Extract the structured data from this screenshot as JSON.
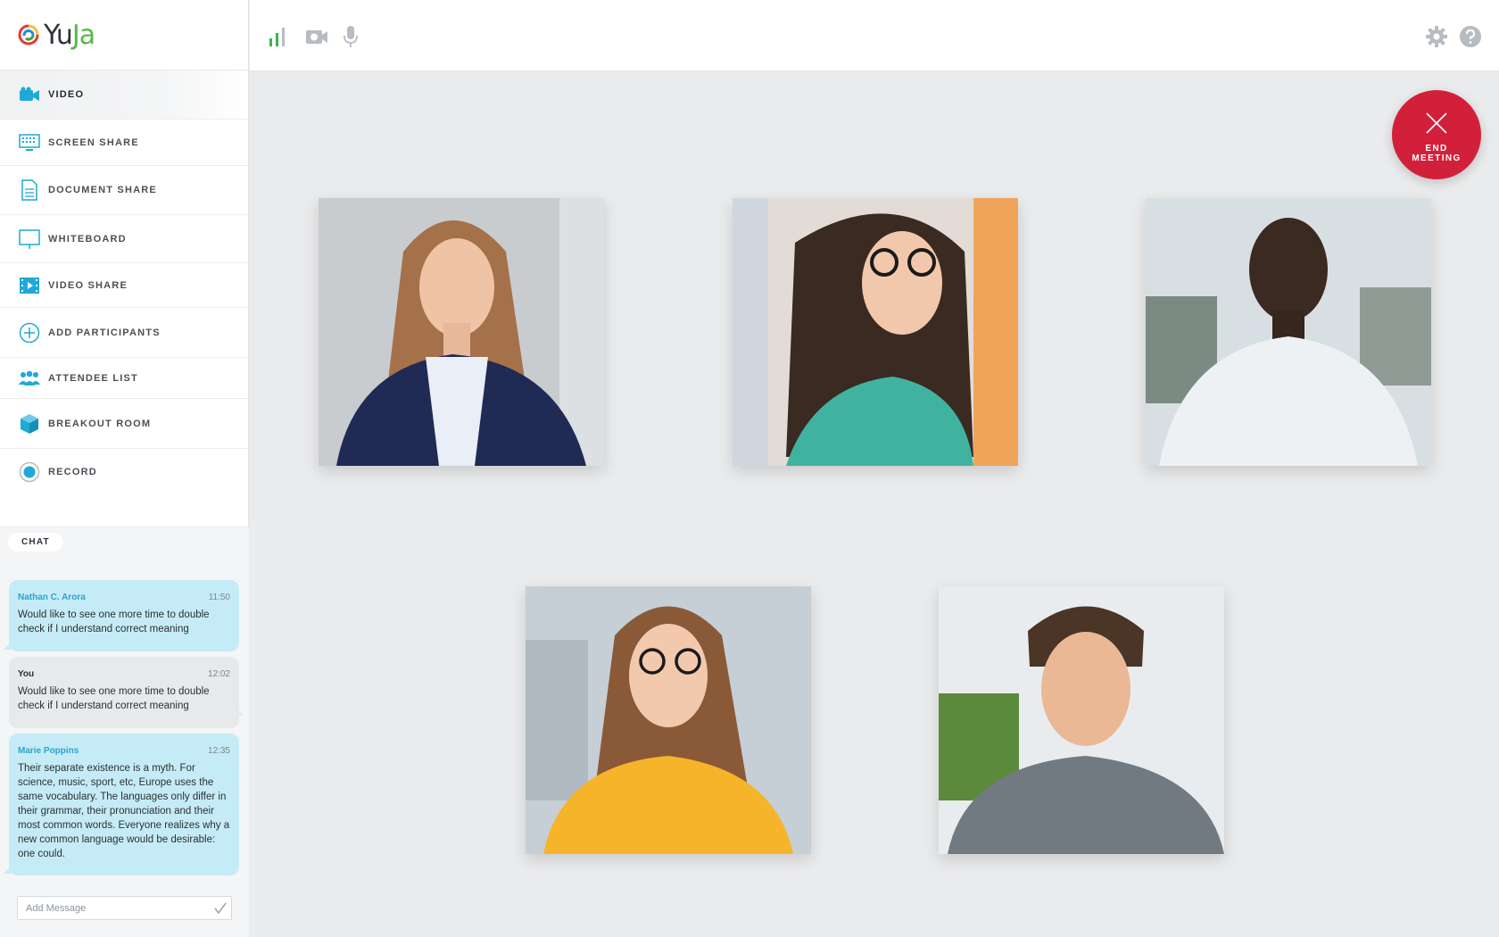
{
  "app": {
    "logo_left": "Yu",
    "logo_right": "Ja"
  },
  "sidebar": {
    "items": [
      {
        "label": "VIDEO",
        "icon": "video-camera-icon",
        "active": true
      },
      {
        "label": "SCREEN SHARE",
        "icon": "screen-share-icon",
        "active": false
      },
      {
        "label": "DOCUMENT SHARE",
        "icon": "document-icon",
        "active": false
      },
      {
        "label": "WHITEBOARD",
        "icon": "whiteboard-icon",
        "active": false
      },
      {
        "label": "VIDEO SHARE",
        "icon": "film-strip-icon",
        "active": false
      },
      {
        "label": "ADD PARTICIPANTS",
        "icon": "plus-circle-icon",
        "active": false
      },
      {
        "label": "ATTENDEE LIST",
        "icon": "people-icon",
        "active": false
      },
      {
        "label": "BREAKOUT ROOM",
        "icon": "cube-icon",
        "active": false
      },
      {
        "label": "RECORD",
        "icon": "record-icon",
        "active": false
      }
    ]
  },
  "chat": {
    "tab_label": "CHAT",
    "messages": [
      {
        "sender": "Nathan C. Arora",
        "time": "11:50",
        "text": "Would like to see one more time to double check if I understand correct meaning",
        "self": false
      },
      {
        "sender": "You",
        "time": "12:02",
        "text": "Would like to see one more time to double check if I understand correct meaning",
        "self": true
      },
      {
        "sender": "Marie Poppins",
        "time": "12:35",
        "text": "Their separate existence is a myth. For science, music, sport, etc, Europe uses the same vocabulary. The languages only differ in their grammar, their pronunciation and their most common words. Everyone realizes why a new common language would be desirable: one could.",
        "self": false
      }
    ],
    "input_placeholder": "Add Message"
  },
  "toolbar": {
    "icons": [
      "signal-bars-icon",
      "camera-icon",
      "microphone-icon",
      "gear-icon",
      "help-icon"
    ],
    "colors": {
      "signal": "#3bb54a",
      "muted": "#b7bcc1"
    }
  },
  "end_meeting": {
    "label": "END MEETING",
    "color": "#d3203a"
  },
  "participants": [
    {
      "tile": "participant-woman-blazer"
    },
    {
      "tile": "participant-woman-glasses"
    },
    {
      "tile": "participant-man-white-shirt"
    },
    {
      "tile": "participant-woman-yellow"
    },
    {
      "tile": "participant-man-grey-shirt"
    }
  ],
  "colors": {
    "accent": "#2aa3cd",
    "bubble_other": "#c5ecf6",
    "bubble_self": "#e8e9eb",
    "background": "#eaebec"
  }
}
